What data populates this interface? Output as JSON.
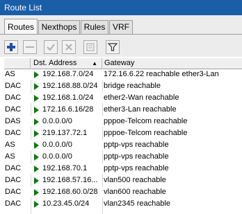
{
  "window": {
    "title": "Route List"
  },
  "tabs": [
    {
      "label": "Routes",
      "active": true
    },
    {
      "label": "Nexthops",
      "active": false
    },
    {
      "label": "Rules",
      "active": false
    },
    {
      "label": "VRF",
      "active": false
    }
  ],
  "toolbar": {
    "buttons": [
      "add-icon",
      "remove-icon",
      "enable-icon",
      "disable-icon",
      "comment-icon",
      "filter-icon"
    ]
  },
  "colors": {
    "titlebar": "#1a5ea8",
    "add": "#1f4fa8",
    "arrow": "#0d7a0d"
  },
  "table": {
    "columns": [
      "",
      "Dst. Address",
      "Gateway"
    ],
    "sort_indicator": "▲",
    "rows": [
      {
        "flags": "AS",
        "dst": "192.168.7.0/24",
        "gateway": "172.16.6.22 reachable ether3-Lan"
      },
      {
        "flags": "DAC",
        "dst": "192.168.88.0/24",
        "gateway": "bridge reachable"
      },
      {
        "flags": "DAC",
        "dst": "192.168.1.0/24",
        "gateway": "ether2-Wan reachable"
      },
      {
        "flags": "DAC",
        "dst": "172.16.6.16/28",
        "gateway": "ether3-Lan reachable"
      },
      {
        "flags": "DAS",
        "dst": "0.0.0.0/0",
        "gateway": "pppoe-Telcom reachable"
      },
      {
        "flags": "DAC",
        "dst": "219.137.72.1",
        "gateway": "pppoe-Telcom reachable"
      },
      {
        "flags": "AS",
        "dst": "0.0.0.0/0",
        "gateway": "pptp-vps reachable"
      },
      {
        "flags": "AS",
        "dst": "0.0.0.0/0",
        "gateway": "pptp-vps reachable"
      },
      {
        "flags": "DAC",
        "dst": "192.168.70.1",
        "gateway": "pptp-vps reachable"
      },
      {
        "flags": "DAC",
        "dst": "192.168.57.16...",
        "gateway": "vlan500 reachable"
      },
      {
        "flags": "DAC",
        "dst": "192.168.60.0/28",
        "gateway": "vlan600 reachable"
      },
      {
        "flags": "DAC",
        "dst": "10.23.45.0/24",
        "gateway": "vlan2345 reachable"
      }
    ]
  }
}
